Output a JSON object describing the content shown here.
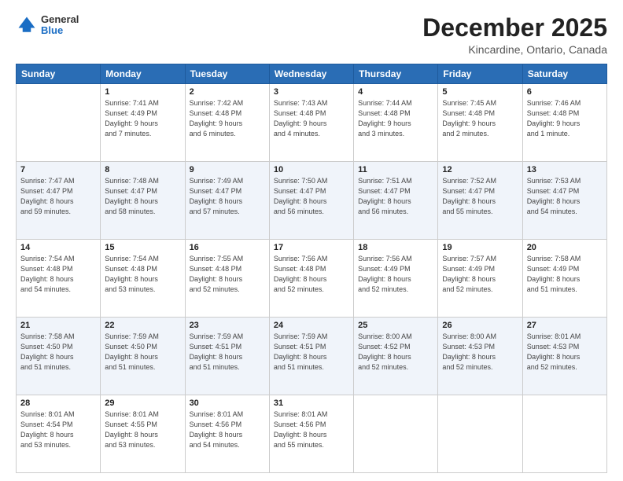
{
  "logo": {
    "general": "General",
    "blue": "Blue"
  },
  "title": {
    "month": "December 2025",
    "location": "Kincardine, Ontario, Canada"
  },
  "days_header": [
    "Sunday",
    "Monday",
    "Tuesday",
    "Wednesday",
    "Thursday",
    "Friday",
    "Saturday"
  ],
  "weeks": [
    [
      {
        "day": "",
        "info": ""
      },
      {
        "day": "1",
        "info": "Sunrise: 7:41 AM\nSunset: 4:49 PM\nDaylight: 9 hours\nand 7 minutes."
      },
      {
        "day": "2",
        "info": "Sunrise: 7:42 AM\nSunset: 4:48 PM\nDaylight: 9 hours\nand 6 minutes."
      },
      {
        "day": "3",
        "info": "Sunrise: 7:43 AM\nSunset: 4:48 PM\nDaylight: 9 hours\nand 4 minutes."
      },
      {
        "day": "4",
        "info": "Sunrise: 7:44 AM\nSunset: 4:48 PM\nDaylight: 9 hours\nand 3 minutes."
      },
      {
        "day": "5",
        "info": "Sunrise: 7:45 AM\nSunset: 4:48 PM\nDaylight: 9 hours\nand 2 minutes."
      },
      {
        "day": "6",
        "info": "Sunrise: 7:46 AM\nSunset: 4:48 PM\nDaylight: 9 hours\nand 1 minute."
      }
    ],
    [
      {
        "day": "7",
        "info": "Sunrise: 7:47 AM\nSunset: 4:47 PM\nDaylight: 8 hours\nand 59 minutes."
      },
      {
        "day": "8",
        "info": "Sunrise: 7:48 AM\nSunset: 4:47 PM\nDaylight: 8 hours\nand 58 minutes."
      },
      {
        "day": "9",
        "info": "Sunrise: 7:49 AM\nSunset: 4:47 PM\nDaylight: 8 hours\nand 57 minutes."
      },
      {
        "day": "10",
        "info": "Sunrise: 7:50 AM\nSunset: 4:47 PM\nDaylight: 8 hours\nand 56 minutes."
      },
      {
        "day": "11",
        "info": "Sunrise: 7:51 AM\nSunset: 4:47 PM\nDaylight: 8 hours\nand 56 minutes."
      },
      {
        "day": "12",
        "info": "Sunrise: 7:52 AM\nSunset: 4:47 PM\nDaylight: 8 hours\nand 55 minutes."
      },
      {
        "day": "13",
        "info": "Sunrise: 7:53 AM\nSunset: 4:47 PM\nDaylight: 8 hours\nand 54 minutes."
      }
    ],
    [
      {
        "day": "14",
        "info": "Sunrise: 7:54 AM\nSunset: 4:48 PM\nDaylight: 8 hours\nand 54 minutes."
      },
      {
        "day": "15",
        "info": "Sunrise: 7:54 AM\nSunset: 4:48 PM\nDaylight: 8 hours\nand 53 minutes."
      },
      {
        "day": "16",
        "info": "Sunrise: 7:55 AM\nSunset: 4:48 PM\nDaylight: 8 hours\nand 52 minutes."
      },
      {
        "day": "17",
        "info": "Sunrise: 7:56 AM\nSunset: 4:48 PM\nDaylight: 8 hours\nand 52 minutes."
      },
      {
        "day": "18",
        "info": "Sunrise: 7:56 AM\nSunset: 4:49 PM\nDaylight: 8 hours\nand 52 minutes."
      },
      {
        "day": "19",
        "info": "Sunrise: 7:57 AM\nSunset: 4:49 PM\nDaylight: 8 hours\nand 52 minutes."
      },
      {
        "day": "20",
        "info": "Sunrise: 7:58 AM\nSunset: 4:49 PM\nDaylight: 8 hours\nand 51 minutes."
      }
    ],
    [
      {
        "day": "21",
        "info": "Sunrise: 7:58 AM\nSunset: 4:50 PM\nDaylight: 8 hours\nand 51 minutes."
      },
      {
        "day": "22",
        "info": "Sunrise: 7:59 AM\nSunset: 4:50 PM\nDaylight: 8 hours\nand 51 minutes."
      },
      {
        "day": "23",
        "info": "Sunrise: 7:59 AM\nSunset: 4:51 PM\nDaylight: 8 hours\nand 51 minutes."
      },
      {
        "day": "24",
        "info": "Sunrise: 7:59 AM\nSunset: 4:51 PM\nDaylight: 8 hours\nand 51 minutes."
      },
      {
        "day": "25",
        "info": "Sunrise: 8:00 AM\nSunset: 4:52 PM\nDaylight: 8 hours\nand 52 minutes."
      },
      {
        "day": "26",
        "info": "Sunrise: 8:00 AM\nSunset: 4:53 PM\nDaylight: 8 hours\nand 52 minutes."
      },
      {
        "day": "27",
        "info": "Sunrise: 8:01 AM\nSunset: 4:53 PM\nDaylight: 8 hours\nand 52 minutes."
      }
    ],
    [
      {
        "day": "28",
        "info": "Sunrise: 8:01 AM\nSunset: 4:54 PM\nDaylight: 8 hours\nand 53 minutes."
      },
      {
        "day": "29",
        "info": "Sunrise: 8:01 AM\nSunset: 4:55 PM\nDaylight: 8 hours\nand 53 minutes."
      },
      {
        "day": "30",
        "info": "Sunrise: 8:01 AM\nSunset: 4:56 PM\nDaylight: 8 hours\nand 54 minutes."
      },
      {
        "day": "31",
        "info": "Sunrise: 8:01 AM\nSunset: 4:56 PM\nDaylight: 8 hours\nand 55 minutes."
      },
      {
        "day": "",
        "info": ""
      },
      {
        "day": "",
        "info": ""
      },
      {
        "day": "",
        "info": ""
      }
    ]
  ]
}
